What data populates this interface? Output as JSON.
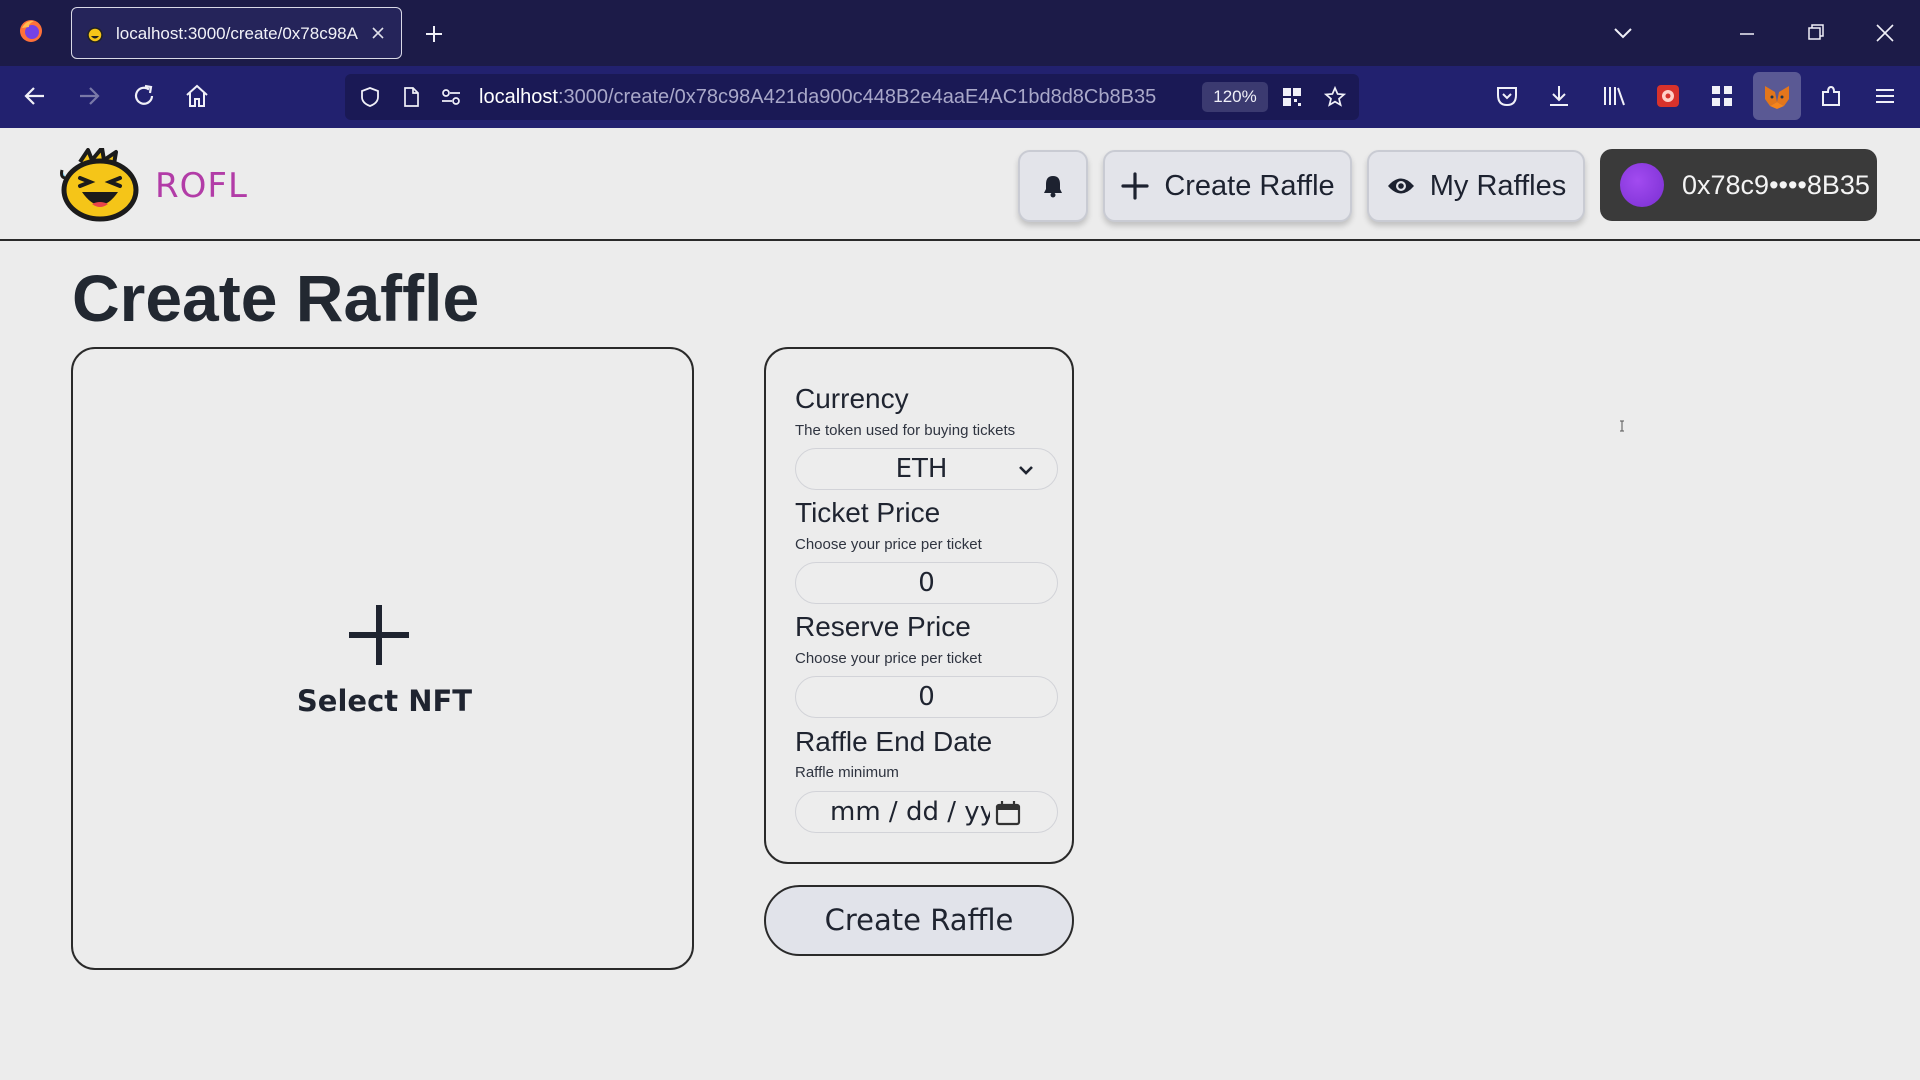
{
  "browser": {
    "tab": {
      "title": "localhost:3000/create/0x78c98A"
    },
    "url": {
      "host": "localhost",
      "path": ":3000/create/0x78c98A421da900c448B2e4aaE4AC1bd8d8Cb8B35"
    },
    "zoom": "120%"
  },
  "site": {
    "brand": "ROFL",
    "header": {
      "create_label": "Create Raffle",
      "myraffles_label": "My Raffles",
      "wallet_address": "0x78c9••••8B35"
    }
  },
  "page": {
    "title": "Create Raffle",
    "nft_picker": {
      "label": "Select NFT"
    },
    "form": {
      "currency": {
        "label": "Currency",
        "help": "The token used for buying tickets",
        "value": "ETH"
      },
      "ticket_price": {
        "label": "Ticket Price",
        "help": "Choose your price per ticket",
        "value": "0"
      },
      "reserve_price": {
        "label": "Reserve Price",
        "help": "Choose your price per ticket",
        "value": "0"
      },
      "end_date": {
        "label": "Raffle End Date",
        "help": "Raffle minimum",
        "placeholder": "mm / dd / yyyy"
      }
    },
    "submit_label": "Create Raffle"
  },
  "colors": {
    "browser_tabbar": "#1c1b48",
    "browser_navbar": "#22216f",
    "brand": "#b23ca7",
    "page_bg": "#ececec",
    "wallet_bg": "#3a3a3a",
    "wallet_avatar": "#8b3be0"
  },
  "icons": [
    "firefox-icon",
    "tab-favicon-icon",
    "close-icon",
    "plus-icon",
    "chevron-down-icon",
    "minimize-icon",
    "restore-icon",
    "back-icon",
    "forward-icon",
    "reload-icon",
    "home-icon",
    "shield-icon",
    "page-icon",
    "permissions-icon",
    "qr-icon",
    "star-icon",
    "pocket-icon",
    "download-icon",
    "library-icon",
    "extension-icon",
    "grid-icon",
    "metamask-icon",
    "puzzle-icon",
    "menu-icon",
    "bell-icon",
    "eye-icon",
    "calendar-icon"
  ]
}
